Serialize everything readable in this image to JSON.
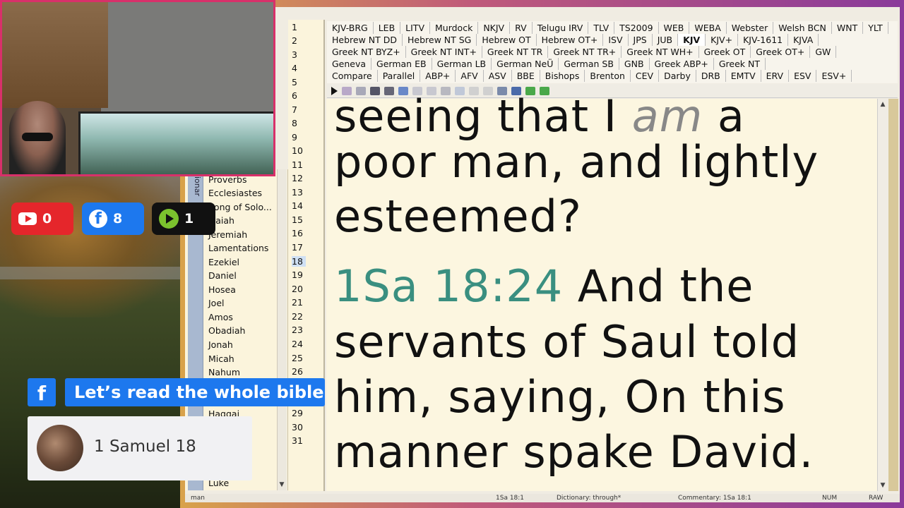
{
  "versions": {
    "row1": [
      "KJV-BRG",
      "LEB",
      "LITV",
      "Murdock",
      "NKJV",
      "RV",
      "Telugu IRV",
      "TLV",
      "TS2009",
      "WEB",
      "WEBA",
      "Webster",
      "Welsh BCN",
      "WNT",
      "YLT"
    ],
    "row2": [
      "Hebrew NT DD",
      "Hebrew NT SG",
      "Hebrew OT",
      "Hebrew OT+",
      "ISV",
      "JPS",
      "JUB",
      "KJV",
      "KJV+",
      "KJV-1611",
      "KJVA"
    ],
    "row3": [
      "Greek NT BYZ+",
      "Greek NT INT+",
      "Greek NT TR",
      "Greek NT TR+",
      "Greek NT WH+",
      "Greek OT",
      "Greek OT+",
      "GW"
    ],
    "row4": [
      "Geneva",
      "German EB",
      "German LB",
      "German NeÜ",
      "German SB",
      "GNB",
      "Greek ABP+",
      "Greek NT"
    ],
    "row5": [
      "Compare",
      "Parallel",
      "ABP+",
      "AFV",
      "ASV",
      "BBE",
      "Bishops",
      "Brenton",
      "CEV",
      "Darby",
      "DRB",
      "EMTV",
      "ERV",
      "ESV",
      "ESV+"
    ],
    "active": "KJV"
  },
  "books": {
    "strip_label": "ionar",
    "items": [
      "Proverbs",
      "Ecclesiastes",
      "Song of Solo...",
      "Isaiah",
      "Jeremiah",
      "Lamentations",
      "Ezekiel",
      "Daniel",
      "Hosea",
      "Joel",
      "Amos",
      "Obadiah",
      "Jonah",
      "Micah",
      "Nahum",
      "Haggai",
      "Luke"
    ]
  },
  "lines": [
    "1",
    "2",
    "3",
    "4",
    "5",
    "6",
    "7",
    "8",
    "9",
    "10",
    "11",
    "12",
    "13",
    "14",
    "15",
    "16",
    "17",
    "18",
    "19",
    "20",
    "21",
    "22",
    "23",
    "24",
    "25",
    "26",
    "29",
    "30",
    "31"
  ],
  "selected_line": "18",
  "text": {
    "line1_pre": "seeing that I ",
    "line1_italic": "am",
    "line1_post": " a",
    "line2": "poor man, and lightly",
    "line3": "esteemed?",
    "ref": "1Sa 18:24",
    "line4_post": "  And the",
    "line5": "servants of Saul told",
    "line6": "him, saying, On this",
    "line7": "manner spake David."
  },
  "status": {
    "left": "man",
    "ref": "1Sa 18:1",
    "dictionary": "Dictionary: through*",
    "commentary": "Commentary: 1Sa 18:1",
    "num": "NUM",
    "raw": "RAW"
  },
  "social": {
    "youtube_count": "0",
    "facebook_count": "8",
    "rumble_count": "1"
  },
  "lower_third": {
    "fb_letter": "f",
    "title": "Let’s read the whole bible",
    "subtitle": "1 Samuel 18"
  },
  "colors": {
    "accent_ref": "#3a8f80",
    "frame_pink": "#d8306a",
    "youtube": "#e5262b",
    "facebook": "#1d78ee",
    "rumble": "#7bc22e"
  }
}
